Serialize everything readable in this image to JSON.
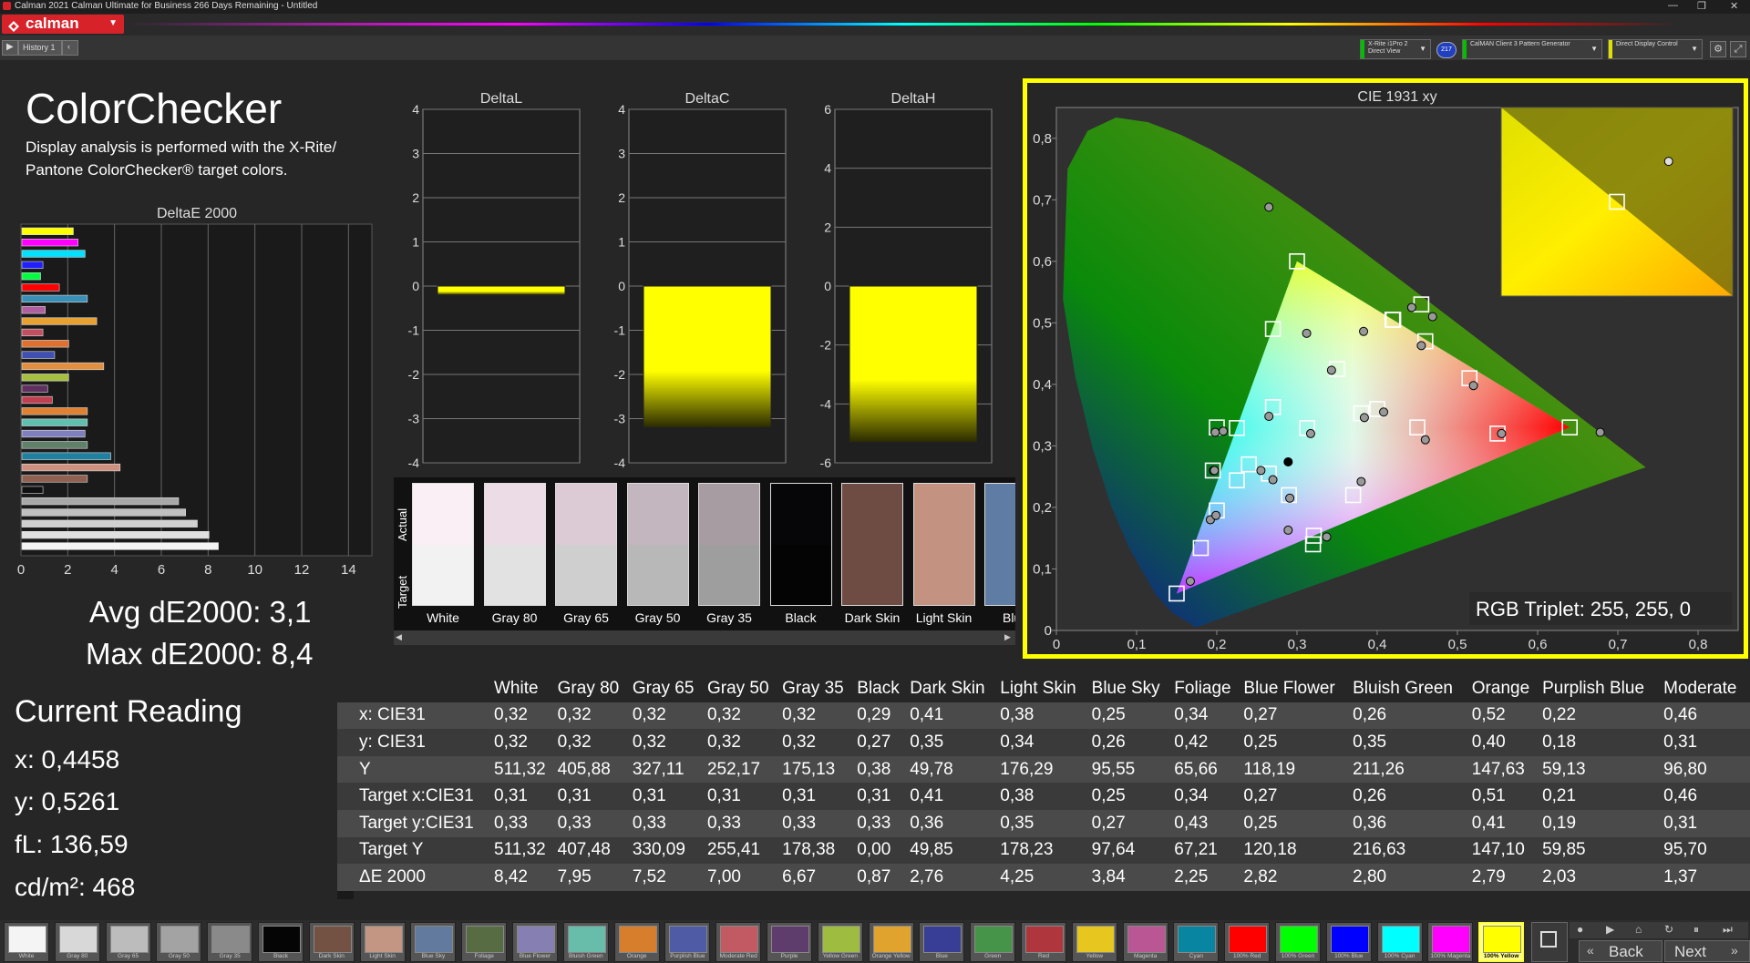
{
  "window": {
    "title": "Calman 2021 Calman Ultimate for Business 266 Days Remaining - Untitled",
    "min": "—",
    "max": "❐",
    "close": "✕"
  },
  "logo": {
    "text": "calman"
  },
  "tabs": {
    "history": "History 1"
  },
  "controls": {
    "meter": {
      "line1": "X-Rite i1Pro 2",
      "line2": "Direct View",
      "badge": "217"
    },
    "generator": {
      "line1": "CalMAN Client 3 Pattern Generator"
    },
    "display": {
      "line1": "Direct Display Control"
    }
  },
  "page": {
    "title": "ColorChecker",
    "desc1": "Display analysis is performed with the X-Rite/",
    "desc2": "Pantone ColorChecker® target colors."
  },
  "deltae": {
    "title": "DeltaE 2000",
    "ticks": [
      "0",
      "2",
      "4",
      "6",
      "8",
      "10",
      "12",
      "14"
    ],
    "bars": [
      {
        "v": 2.2,
        "c": "#ffff00"
      },
      {
        "v": 2.4,
        "c": "#ff00ff"
      },
      {
        "v": 2.7,
        "c": "#00e0ff"
      },
      {
        "v": 0.9,
        "c": "#2020ff"
      },
      {
        "v": 0.8,
        "c": "#00ff40"
      },
      {
        "v": 1.6,
        "c": "#ff0000"
      },
      {
        "v": 2.8,
        "c": "#3a8fb8"
      },
      {
        "v": 1.0,
        "c": "#b060a0"
      },
      {
        "v": 3.2,
        "c": "#e8a030"
      },
      {
        "v": 0.9,
        "c": "#c05060"
      },
      {
        "v": 2.0,
        "c": "#e07030"
      },
      {
        "v": 1.4,
        "c": "#4050b0"
      },
      {
        "v": 3.5,
        "c": "#e09040"
      },
      {
        "v": 2.0,
        "c": "#a8c040"
      },
      {
        "v": 1.1,
        "c": "#603060"
      },
      {
        "v": 1.3,
        "c": "#c04050"
      },
      {
        "v": 2.8,
        "c": "#e08030"
      },
      {
        "v": 2.8,
        "c": "#60c0b0"
      },
      {
        "v": 2.7,
        "c": "#8080c0"
      },
      {
        "v": 2.8,
        "c": "#60806a"
      },
      {
        "v": 3.8,
        "c": "#2080a0"
      },
      {
        "v": 4.2,
        "c": "#d09080"
      },
      {
        "v": 2.8,
        "c": "#906050"
      },
      {
        "v": 0.9,
        "c": "#111111"
      },
      {
        "v": 6.7,
        "c": "#a8a8a8"
      },
      {
        "v": 7.0,
        "c": "#c0c0c0"
      },
      {
        "v": 7.5,
        "c": "#d0d0d0"
      },
      {
        "v": 8.0,
        "c": "#e0e0e0"
      },
      {
        "v": 8.4,
        "c": "#f4f4f4"
      }
    ]
  },
  "stats": {
    "avg": "Avg dE2000: 3,1",
    "max": "Max dE2000: 8,4"
  },
  "current": {
    "title": "Current Reading",
    "x": "x: 0,4458",
    "y": "y: 0,5261",
    "fl": "fL: 136,59",
    "cd": "cd/m²: 468"
  },
  "deltal": {
    "title": "DeltaL",
    "ticks": [
      "4",
      "3",
      "2",
      "1",
      "0",
      "-1",
      "-2",
      "-3",
      "-4"
    ],
    "min": -4,
    "max": 4,
    "value": -0.2
  },
  "deltac": {
    "title": "DeltaC",
    "ticks": [
      "4",
      "3",
      "2",
      "1",
      "0",
      "-1",
      "-2",
      "-3",
      "-4"
    ],
    "min": -4,
    "max": 4,
    "value": -3.2
  },
  "deltah": {
    "title": "DeltaH",
    "ticks": [
      "6",
      "4",
      "2",
      "0",
      "-2",
      "-4",
      "-6"
    ],
    "min": -6,
    "max": 6,
    "value": -5.3
  },
  "patches": {
    "actual_label": "Actual",
    "target_label": "Target",
    "items": [
      {
        "name": "White",
        "actual": "#fbeff6",
        "target": "#f2f2f2"
      },
      {
        "name": "Gray 80",
        "actual": "#ecdce6",
        "target": "#e2e2e2"
      },
      {
        "name": "Gray 65",
        "actual": "#dccbd5",
        "target": "#cfcfcf"
      },
      {
        "name": "Gray 50",
        "actual": "#c4b6bf",
        "target": "#b8b8b8"
      },
      {
        "name": "Gray 35",
        "actual": "#a89ca3",
        "target": "#9e9e9e"
      },
      {
        "name": "Black",
        "actual": "#060608",
        "target": "#040404"
      },
      {
        "name": "Dark Skin",
        "actual": "#6e4b43",
        "target": "#6e4b43"
      },
      {
        "name": "Light Skin",
        "actual": "#c49280",
        "target": "#c49280"
      },
      {
        "name": "Blue",
        "actual": "#5f7da4",
        "target": "#5f7da4"
      }
    ]
  },
  "cie": {
    "title": "CIE 1931 xy",
    "xticks": [
      "0",
      "0,1",
      "0,2",
      "0,3",
      "0,4",
      "0,5",
      "0,6",
      "0,7",
      "0,8"
    ],
    "yticks": [
      "0",
      "0,1",
      "0,2",
      "0,3",
      "0,4",
      "0,5",
      "0,6",
      "0,7",
      "0,8"
    ],
    "triplet": "RGB Triplet: 255, 255, 0",
    "targets": [
      [
        0.64,
        0.33
      ],
      [
        0.3,
        0.6
      ],
      [
        0.15,
        0.06
      ],
      [
        0.3127,
        0.329
      ],
      [
        0.419,
        0.505
      ],
      [
        0.225,
        0.329
      ],
      [
        0.321,
        0.154
      ],
      [
        0.4,
        0.36
      ],
      [
        0.38,
        0.353
      ],
      [
        0.27,
        0.49
      ],
      [
        0.455,
        0.53
      ],
      [
        0.225,
        0.244
      ],
      [
        0.18,
        0.134
      ],
      [
        0.24,
        0.27
      ],
      [
        0.265,
        0.255
      ],
      [
        0.2,
        0.195
      ],
      [
        0.27,
        0.363
      ],
      [
        0.35,
        0.425
      ],
      [
        0.515,
        0.41
      ],
      [
        0.46,
        0.47
      ],
      [
        0.42,
        0.505
      ],
      [
        0.55,
        0.32
      ],
      [
        0.45,
        0.33
      ],
      [
        0.37,
        0.22
      ],
      [
        0.29,
        0.22
      ],
      [
        0.32,
        0.14
      ],
      [
        0.2,
        0.33
      ],
      [
        0.195,
        0.26
      ]
    ],
    "measured": [
      [
        0.678,
        0.322
      ],
      [
        0.265,
        0.688
      ],
      [
        0.167,
        0.08
      ],
      [
        0.317,
        0.32
      ],
      [
        0.443,
        0.525
      ],
      [
        0.208,
        0.324
      ],
      [
        0.289,
        0.163
      ],
      [
        0.384,
        0.346
      ],
      [
        0.408,
        0.355
      ],
      [
        0.312,
        0.483
      ],
      [
        0.469,
        0.51
      ],
      [
        0.196,
        0.26
      ],
      [
        0.192,
        0.18
      ],
      [
        0.255,
        0.26
      ],
      [
        0.27,
        0.245
      ],
      [
        0.199,
        0.187
      ],
      [
        0.265,
        0.348
      ],
      [
        0.343,
        0.423
      ],
      [
        0.52,
        0.398
      ],
      [
        0.455,
        0.463
      ],
      [
        0.383,
        0.486
      ],
      [
        0.555,
        0.32
      ],
      [
        0.46,
        0.31
      ],
      [
        0.38,
        0.242
      ],
      [
        0.291,
        0.215
      ],
      [
        0.337,
        0.152
      ],
      [
        0.198,
        0.322
      ],
      [
        0.197,
        0.26
      ],
      [
        0.289,
        0.274
      ]
    ],
    "inset": {
      "target": [
        0.419,
        0.505
      ],
      "measured": [
        0.4458,
        0.5261
      ]
    }
  },
  "table": {
    "columns": [
      "",
      "White",
      "Gray 80",
      "Gray 65",
      "Gray 50",
      "Gray 35",
      "Black",
      "Dark Skin",
      "Light Skin",
      "Blue Sky",
      "Foliage",
      "Blue Flower",
      "Bluish Green",
      "Orange",
      "Purplish Blue",
      "Moderate"
    ],
    "rows": [
      [
        "x: CIE31",
        "0,32",
        "0,32",
        "0,32",
        "0,32",
        "0,32",
        "0,29",
        "0,41",
        "0,38",
        "0,25",
        "0,34",
        "0,27",
        "0,26",
        "0,52",
        "0,22",
        "0,46"
      ],
      [
        "y: CIE31",
        "0,32",
        "0,32",
        "0,32",
        "0,32",
        "0,32",
        "0,27",
        "0,35",
        "0,34",
        "0,26",
        "0,42",
        "0,25",
        "0,35",
        "0,40",
        "0,18",
        "0,31"
      ],
      [
        "Y",
        "511,32",
        "405,88",
        "327,11",
        "252,17",
        "175,13",
        "0,38",
        "49,78",
        "176,29",
        "95,55",
        "65,66",
        "118,19",
        "211,26",
        "147,63",
        "59,13",
        "96,80"
      ],
      [
        "Target x:CIE31",
        "0,31",
        "0,31",
        "0,31",
        "0,31",
        "0,31",
        "0,31",
        "0,41",
        "0,38",
        "0,25",
        "0,34",
        "0,27",
        "0,26",
        "0,51",
        "0,21",
        "0,46"
      ],
      [
        "Target y:CIE31",
        "0,33",
        "0,33",
        "0,33",
        "0,33",
        "0,33",
        "0,33",
        "0,36",
        "0,35",
        "0,27",
        "0,43",
        "0,25",
        "0,36",
        "0,41",
        "0,19",
        "0,31"
      ],
      [
        "Target Y",
        "511,32",
        "407,48",
        "330,09",
        "255,41",
        "178,38",
        "0,00",
        "49,85",
        "178,23",
        "97,64",
        "67,21",
        "120,18",
        "216,63",
        "147,10",
        "59,85",
        "95,70"
      ],
      [
        "ΔE 2000",
        "8,42",
        "7,95",
        "7,52",
        "7,00",
        "6,67",
        "0,87",
        "2,76",
        "4,25",
        "3,84",
        "2,25",
        "2,82",
        "2,80",
        "2,79",
        "2,03",
        "1,37"
      ]
    ]
  },
  "swatches": [
    {
      "n": "White",
      "c": "#f4f4f4"
    },
    {
      "n": "Gray 80",
      "c": "#d8d8d8"
    },
    {
      "n": "Gray 65",
      "c": "#bcbcbc"
    },
    {
      "n": "Gray 50",
      "c": "#a3a3a3"
    },
    {
      "n": "Gray 35",
      "c": "#8a8a8a"
    },
    {
      "n": "Black",
      "c": "#050505"
    },
    {
      "n": "Dark Skin",
      "c": "#735244"
    },
    {
      "n": "Light Skin",
      "c": "#c29682"
    },
    {
      "n": "Blue Sky",
      "c": "#627a9d"
    },
    {
      "n": "Foliage",
      "c": "#576c43"
    },
    {
      "n": "Blue Flower",
      "c": "#8580b1"
    },
    {
      "n": "Bluish Green",
      "c": "#67bdaa"
    },
    {
      "n": "Orange",
      "c": "#d67e2c"
    },
    {
      "n": "Purplish Blue",
      "c": "#505ba6"
    },
    {
      "n": "Moderate Red",
      "c": "#c15a63"
    },
    {
      "n": "Purple",
      "c": "#5e3c6c"
    },
    {
      "n": "Yellow Green",
      "c": "#9dbc40"
    },
    {
      "n": "Orange Yellow",
      "c": "#e0a32e"
    },
    {
      "n": "Blue",
      "c": "#383d96"
    },
    {
      "n": "Green",
      "c": "#469449"
    },
    {
      "n": "Red",
      "c": "#af363c"
    },
    {
      "n": "Yellow",
      "c": "#e7c71f"
    },
    {
      "n": "Magenta",
      "c": "#bb5695"
    },
    {
      "n": "Cyan",
      "c": "#0885a1"
    },
    {
      "n": "100% Red",
      "c": "#ff0000"
    },
    {
      "n": "100% Green",
      "c": "#00ff00"
    },
    {
      "n": "100% Blue",
      "c": "#0000ff"
    },
    {
      "n": "100% Cyan",
      "c": "#00ffff"
    },
    {
      "n": "100% Magenta",
      "c": "#ff00ff"
    },
    {
      "n": "100% Yellow",
      "c": "#ffff00"
    }
  ],
  "nav": {
    "back": "Back",
    "next": "Next"
  },
  "colors": {
    "accent": "#ffff00",
    "brand": "#d8222a"
  }
}
